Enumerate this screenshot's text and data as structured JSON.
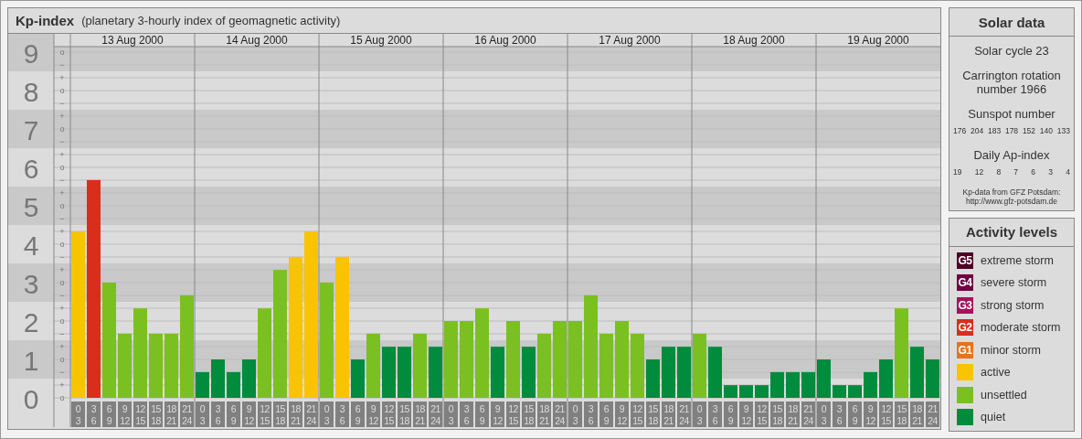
{
  "header": {
    "title": "Kp-index",
    "subtitle": "(planetary 3-hourly index of geomagnetic activity)"
  },
  "chart": {
    "date_headers": [
      "13 Aug 2000",
      "14 Aug 2000",
      "15 Aug 2000",
      "16 Aug 2000",
      "17 Aug 2000",
      "18 Aug 2000",
      "19 Aug 2000"
    ],
    "scale_marks": [
      "o",
      "−",
      "+",
      "o",
      "−",
      "+",
      "o",
      "−",
      "+",
      "o",
      "−",
      "+",
      "o",
      "−",
      "+",
      "o",
      "−",
      "+",
      "o",
      "−",
      "+",
      "o",
      "−",
      "+",
      "o",
      "−",
      "+",
      "o"
    ],
    "chart_data": {
      "type": "bar",
      "grid": true,
      "ylim": [
        0,
        9
      ],
      "categories": [
        "0 3",
        "3 6",
        "6 9",
        "9 12",
        "12 15",
        "15 18",
        "18 21",
        "21 24",
        "0 3",
        "3 6",
        "6 9",
        "9 12",
        "12 15",
        "15 18",
        "18 21",
        "21 24",
        "0 3",
        "3 6",
        "6 9",
        "9 12",
        "12 15",
        "15 18",
        "18 21",
        "21 24",
        "0 3",
        "3 6",
        "6 9",
        "9 12",
        "12 15",
        "15 18",
        "18 21",
        "21 24",
        "0 3",
        "3 6",
        "6 9",
        "9 12",
        "12 15",
        "15 18",
        "18 21",
        "21 24",
        "0 3",
        "3 6",
        "6 9",
        "9 12",
        "12 15",
        "15 18",
        "18 21",
        "21 24",
        "0 3",
        "3 6",
        "6 9",
        "9 12",
        "12 15",
        "15 18",
        "18 21",
        "21 24"
      ],
      "yticks": [
        0,
        1,
        2,
        3,
        4,
        5,
        6,
        7,
        8,
        9
      ],
      "series": [
        {
          "color": "#008c3c",
          "values": [
            null,
            null,
            null,
            null,
            null,
            null,
            null,
            null,
            0.67,
            1,
            0.67,
            1,
            null,
            null,
            null,
            null,
            null,
            null,
            1,
            null,
            1.33,
            1.33,
            null,
            1.33,
            null,
            null,
            null,
            1.33,
            null,
            1.33,
            null,
            null,
            null,
            null,
            null,
            null,
            null,
            1,
            1.33,
            1.33,
            null,
            1.33,
            0.33,
            0.33,
            0.33,
            0.67,
            0.67,
            0.67,
            1,
            0.33,
            0.33,
            0.67,
            1,
            null,
            1.33,
            1
          ]
        },
        {
          "color": "#7ac021",
          "values": [
            null,
            null,
            3,
            1.67,
            2.33,
            1.67,
            1.67,
            2.67,
            null,
            null,
            null,
            null,
            2.33,
            3.33,
            null,
            null,
            3,
            null,
            null,
            1.67,
            null,
            null,
            1.67,
            null,
            2,
            2,
            2.33,
            null,
            2,
            null,
            1.67,
            2,
            2,
            2.67,
            1.67,
            2,
            1.67,
            null,
            null,
            null,
            1.67,
            null,
            null,
            null,
            null,
            null,
            null,
            null,
            null,
            null,
            null,
            null,
            null,
            2.33,
            null,
            null
          ]
        },
        {
          "color": "#f8c400",
          "values": [
            4.33,
            null,
            null,
            null,
            null,
            null,
            null,
            null,
            null,
            null,
            null,
            null,
            null,
            null,
            3.67,
            4.33,
            null,
            3.67,
            null,
            null,
            null,
            null,
            null,
            null,
            null,
            null,
            null,
            null,
            null,
            null,
            null,
            null,
            null,
            null,
            null,
            null,
            null,
            null,
            null,
            null,
            null,
            null,
            null,
            null,
            null,
            null,
            null,
            null,
            null,
            null,
            null,
            null,
            null,
            null,
            null,
            null
          ]
        },
        {
          "color": "#d92e1c",
          "values": [
            null,
            5.67,
            null,
            null,
            null,
            null,
            null,
            null,
            null,
            null,
            null,
            null,
            null,
            null,
            null,
            null,
            null,
            null,
            null,
            null,
            null,
            null,
            null,
            null,
            null,
            null,
            null,
            null,
            null,
            null,
            null,
            null,
            null,
            null,
            null,
            null,
            null,
            null,
            null,
            null,
            null,
            null,
            null,
            null,
            null,
            null,
            null,
            null,
            null,
            null,
            null,
            null,
            null,
            null,
            null,
            null
          ]
        }
      ]
    }
  },
  "solar_data": {
    "title": "Solar data",
    "solar_cycle": "Solar cycle 23",
    "carrington": "Carrington rotation number 1966",
    "sunspot_label": "Sunspot number",
    "sunspot_numbers": [
      "176",
      "204",
      "183",
      "178",
      "152",
      "140",
      "133"
    ],
    "ap_label": "Daily Ap-index",
    "ap_values": [
      "19",
      "12",
      "8",
      "7",
      "6",
      "3",
      "4"
    ],
    "source": "Kp-data from GFZ Potsdam:",
    "source_url": "http://www.gfz-potsdam.de"
  },
  "activity_levels": {
    "title": "Activity levels",
    "items": [
      {
        "badge": "G5",
        "label": "extreme storm",
        "color": "#4e0024"
      },
      {
        "badge": "G4",
        "label": "severe storm",
        "color": "#6c0040"
      },
      {
        "badge": "G3",
        "label": "strong storm",
        "color": "#a8105c"
      },
      {
        "badge": "G2",
        "label": "moderate storm",
        "color": "#d92e1c"
      },
      {
        "badge": "G1",
        "label": "minor storm",
        "color": "#e8731a"
      },
      {
        "label": "active",
        "color": "#f8c400"
      },
      {
        "label": "unsettled",
        "color": "#7ac021"
      },
      {
        "label": "quiet",
        "color": "#008c3c"
      }
    ]
  }
}
